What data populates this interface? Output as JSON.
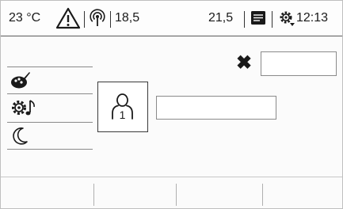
{
  "status": {
    "temperature": "23 °C",
    "temp_left": "18,5",
    "temp_right": "21,5",
    "clock": "12:13"
  },
  "icons": {
    "warning": "warning-triangle-icon",
    "antenna": "radio-signal-icon",
    "notes": "messages-icon",
    "settings": "settings-gear-icon",
    "close": "close-icon",
    "color_theme": "color-palette-icon",
    "sound_settings": "sound-settings-icon",
    "night_mode": "night-mode-moon-icon",
    "profile": "user-profile-1-icon"
  },
  "profile": {
    "number": "1"
  },
  "colors": {
    "accent": "#1a1a1a",
    "border": "#8a8a8a"
  }
}
